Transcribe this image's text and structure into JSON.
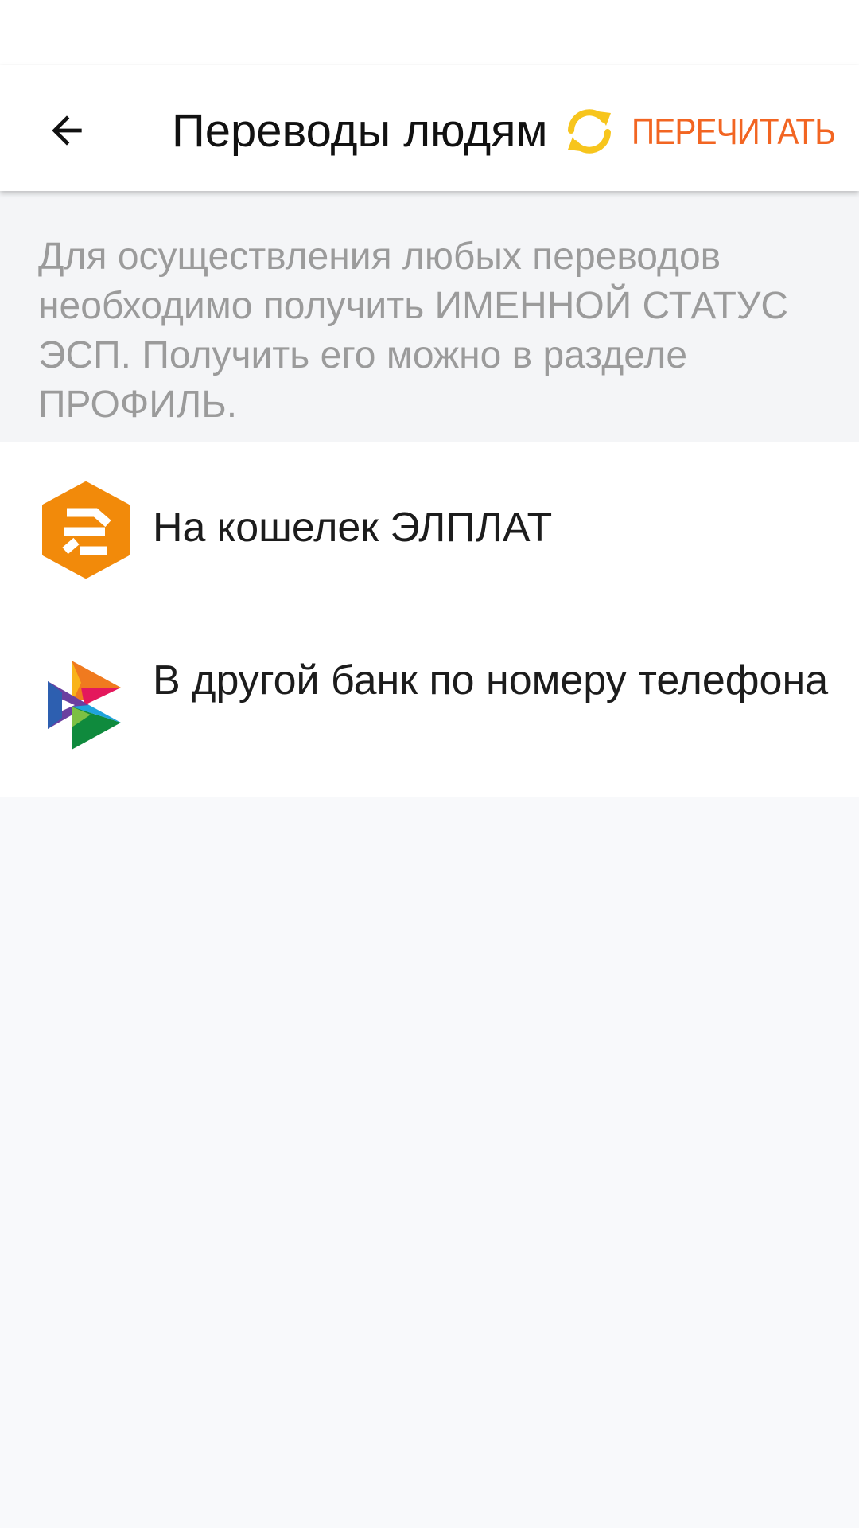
{
  "header": {
    "title": "Переводы людям",
    "refresh_label": "ПЕРЕЧИТАТЬ",
    "back_icon": "arrow-left-icon",
    "refresh_icon": "refresh-icon"
  },
  "notice": {
    "text": "Для осуществления любых переводов необходимо получить ИМЕННОЙ СТАТУС ЭСП. Получить его можно в разделе ПРОФИЛЬ."
  },
  "transfer_options": [
    {
      "label": "На кошелек ЭЛПЛАТ",
      "icon": "elplat-logo-icon"
    },
    {
      "label": "В другой банк по номеру телефона",
      "icon": "sbp-logo-icon"
    }
  ],
  "colors": {
    "accent": "#f26522",
    "refresh_icon": "#f7c51d",
    "elplat_orange": "#f28a0a",
    "notice_text": "#9b9b9b",
    "page_background": "#f8f9fb"
  }
}
